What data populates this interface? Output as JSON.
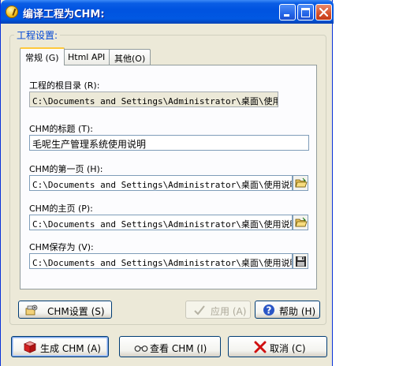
{
  "window": {
    "title": "编译工程为CHM:"
  },
  "group": {
    "label": "工程设置:"
  },
  "tabs": [
    {
      "label": "常规 (G)"
    },
    {
      "label": "Html API"
    },
    {
      "label": "其他(O)"
    }
  ],
  "fields": {
    "root_dir": {
      "label": "工程的根目录 (R):",
      "value": "C:\\Documents and Settings\\Administrator\\桌面\\使用说明"
    },
    "chm_title": {
      "label": "CHM的标题 (T):",
      "value": "毛呢生产管理系统使用说明"
    },
    "first_page": {
      "label": "CHM的第一页 (H):",
      "value": "C:\\Documents and Settings\\Administrator\\桌面\\使用说明\\f"
    },
    "home_page": {
      "label": "CHM的主页 (P):",
      "value": "C:\\Documents and Settings\\Administrator\\桌面\\使用说明\\f"
    },
    "save_as": {
      "label": "CHM保存为 (V):",
      "value": "C:\\Documents and Settings\\Administrator\\桌面\\使用说明.c"
    }
  },
  "buttons": {
    "chm_settings": "CHM设置 (S)",
    "apply": "应用 (A)",
    "help": "帮助 (H)",
    "build": "生成 CHM (A)",
    "view": "查看 CHM (I)",
    "cancel": "取消 (C)"
  },
  "icons": {
    "app": "app-icon",
    "folder": "folder-open-icon",
    "save": "floppy-disk-icon",
    "settings": "settings-icon",
    "check": "checkmark-icon",
    "help": "help-question-icon",
    "book": "red-book-icon",
    "glasses": "glasses-icon",
    "cancel": "red-x-icon"
  },
  "colors": {
    "title_bar": "#0053e0",
    "group_label": "#0046d5",
    "dialog_bg": "#ece9d8",
    "active_tab_accent": "#ffc83c"
  }
}
